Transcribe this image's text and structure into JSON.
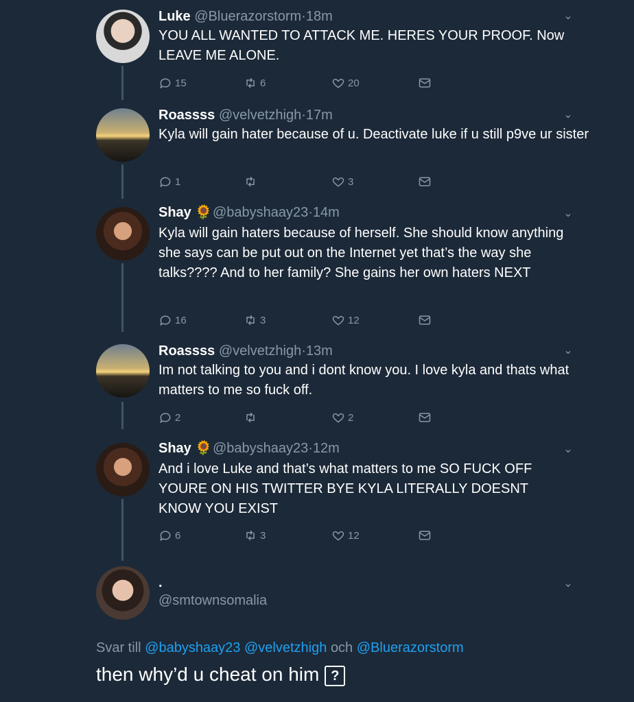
{
  "tweets": [
    {
      "name": "Luke",
      "handle": "@Bluerazorstorm",
      "time": "18m",
      "text": "YOU ALL WANTED TO ATTACK ME. HERES YOUR PROOF. Now LEAVE ME ALONE.",
      "replies": "15",
      "retweets": "6",
      "likes": "20"
    },
    {
      "name": "Roassss",
      "handle": "@velvetzhigh",
      "time": "17m",
      "text": "Kyla will gain hater because of u. Deactivate luke if u still p9ve ur sister",
      "replies": "1",
      "retweets": "",
      "likes": "3"
    },
    {
      "name": "Shay",
      "emoji": "🌻",
      "handle": "@babyshaay23",
      "time": "14m",
      "text": "Kyla will gain haters because of herself. She should know anything she says can be put out on the Internet yet that’s the way she talks???? And to her family?  She gains her own haters NEXT",
      "replies": "16",
      "retweets": "3",
      "likes": "12"
    },
    {
      "name": "Roassss",
      "handle": "@velvetzhigh",
      "time": "13m",
      "text": "Im not talking to you and i dont know you. I love kyla and thats what matters to me so fuck off.",
      "replies": "2",
      "retweets": "",
      "likes": "2"
    },
    {
      "name": "Shay",
      "emoji": "🌻",
      "handle": "@babyshaay23",
      "time": "12m",
      "text": "And i love Luke and that’s what matters to me SO FUCK OFF YOURE ON HIS TWITTER BYE KYLA LITERALLY DOESNT KNOW YOU EXIST",
      "replies": "6",
      "retweets": "3",
      "likes": "12"
    }
  ],
  "reply_user": {
    "name": ".",
    "handle": "@smtownsomalia"
  },
  "reply_to": {
    "prefix": "Svar till",
    "user1": "@babyshaay23",
    "user2": "@velvetzhigh",
    "connector": "och",
    "user3": "@Bluerazorstorm"
  },
  "reply_text": "then why’d u cheat on him",
  "reply_symbol": "?",
  "separator": "·",
  "colors": {
    "background": "#1c2938",
    "text": "#ffffff",
    "muted": "#8899a6",
    "link": "#1da1f2"
  },
  "icons": [
    "reply-icon",
    "retweet-icon",
    "like-icon",
    "dm-icon",
    "chevron-down-icon"
  ]
}
